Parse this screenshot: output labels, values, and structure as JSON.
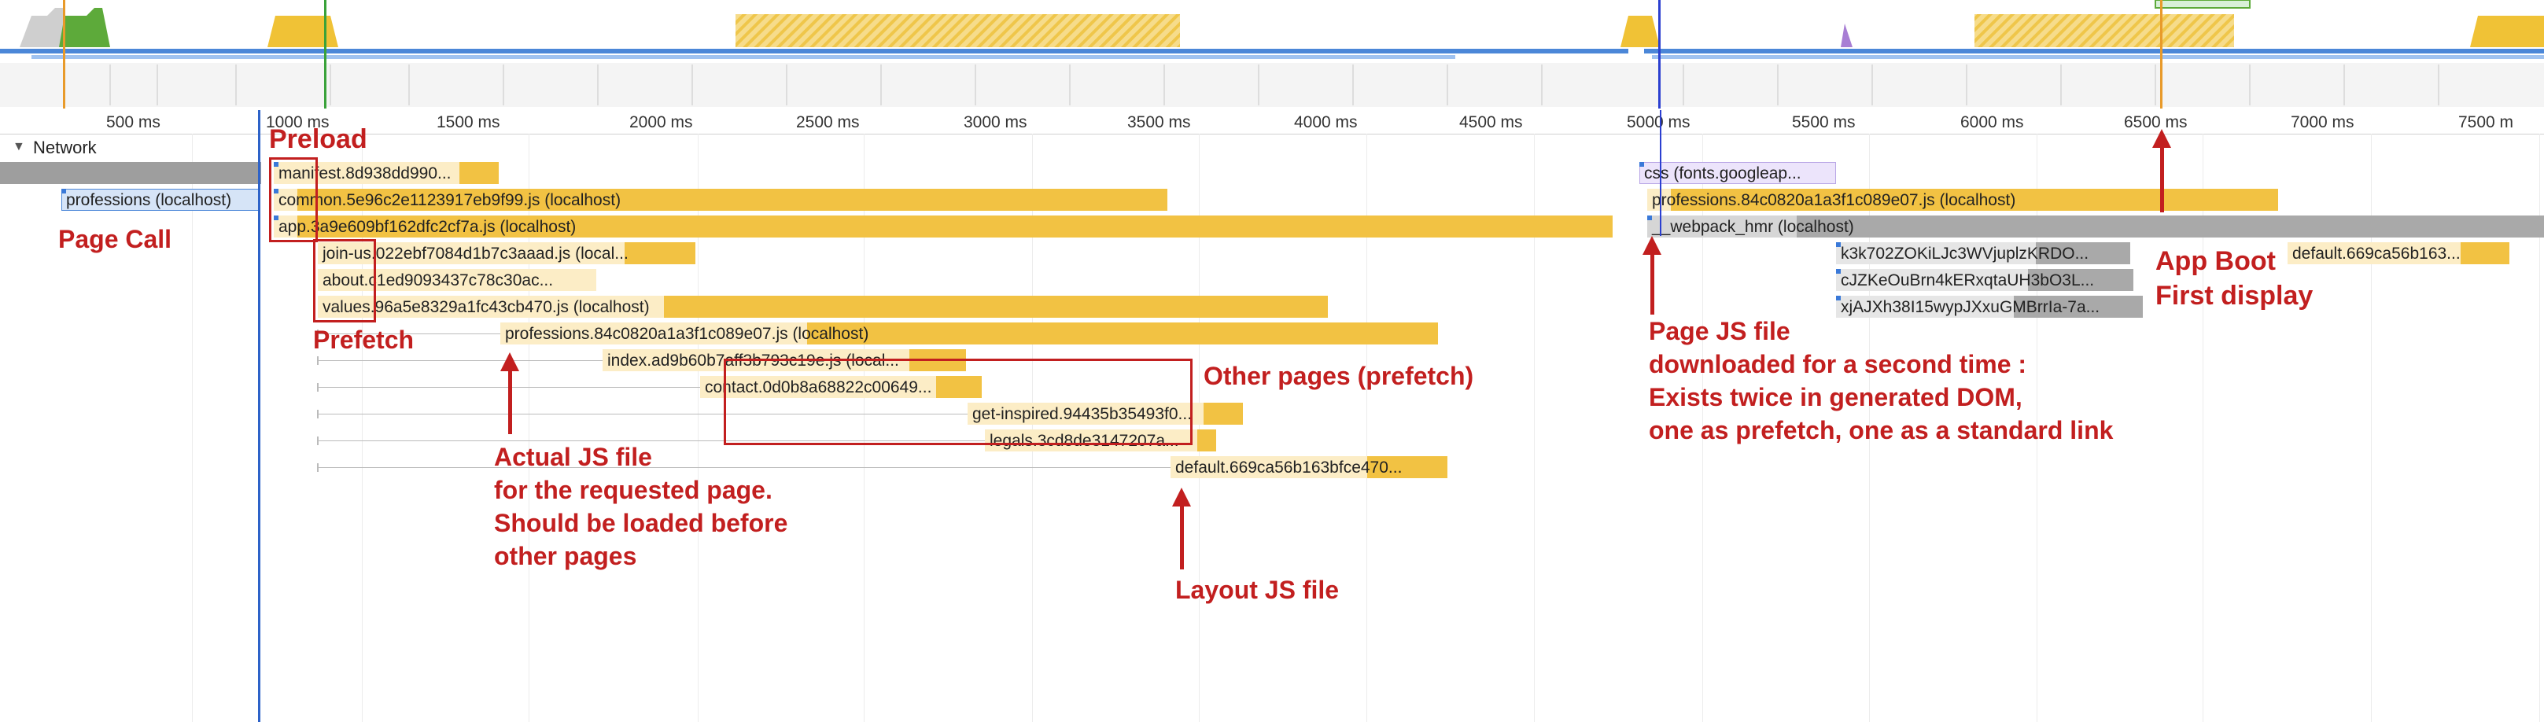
{
  "ruler": {
    "ticks": [
      "500 ms",
      "1000 ms",
      "1500 ms",
      "2000 ms",
      "2500 ms",
      "3000 ms",
      "3500 ms",
      "4000 ms",
      "4500 ms",
      "5000 ms",
      "5500 ms",
      "6000 ms",
      "6500 ms",
      "7000 ms",
      "7500 m"
    ]
  },
  "network": {
    "title": "Network",
    "expand_icon": "triangle-down-icon"
  },
  "requests": [
    {
      "label": "professions (localhost)"
    },
    {
      "label": "manifest.8d938dd990..."
    },
    {
      "label": "common.5e96c2e1123917eb9f99.js (localhost)"
    },
    {
      "label": "app.3a9e609bf162dfc2cf7a.js (localhost)"
    },
    {
      "label": "join-us.022ebf7084d1b7c3aaad.js (local..."
    },
    {
      "label": "about.c1ed9093437c78c30ac..."
    },
    {
      "label": "values.96a5e8329a1fc43cb470.js (localhost)"
    },
    {
      "label": "professions.84c0820a1a3f1c089e07.js (localhost)"
    },
    {
      "label": "index.ad9b60b7aff3b793c19e.js (local..."
    },
    {
      "label": "contact.0d0b8a68822c00649..."
    },
    {
      "label": "get-inspired.94435b35493f0..."
    },
    {
      "label": "legals.3cd8de3147207a..."
    },
    {
      "label": "default.669ca56b163bfce470..."
    },
    {
      "label": "css (fonts.googleap..."
    },
    {
      "label": "professions.84c0820a1a3f1c089e07.js (localhost)"
    },
    {
      "label": "__webpack_hmr (localhost)"
    },
    {
      "label": "k3k702ZOKiLJc3WVjuplzKRDO..."
    },
    {
      "label": "cJZKeOuBrn4kERxqtaUH3bO3L..."
    },
    {
      "label": "xjAJXh38I15wypJXxuGMBrrIa-7a..."
    },
    {
      "label": "default.669ca56b163..."
    }
  ],
  "annotations": {
    "preload": "Preload",
    "page_call": "Page Call",
    "prefetch": "Prefetch",
    "actual_js": [
      "Actual JS file",
      "for the requested page.",
      "Should be loaded before",
      "other pages"
    ],
    "other_pages": "Other pages (prefetch)",
    "layout_js": "Layout JS file",
    "page_js_second": [
      "Page JS file",
      "downloaded for a second time :",
      "Exists twice in generated DOM,",
      "one as prefetch, one as a standard link"
    ],
    "app_boot": [
      "App Boot",
      "First display"
    ]
  },
  "colors": {
    "annotation_red": "#c21f1f",
    "script_bar": "#f2c243",
    "script_wait": "#fcedc6",
    "doc_bar": "#4b87d8",
    "hmr_bar": "#a9a9a9",
    "css_bar": "#ece4fb"
  }
}
